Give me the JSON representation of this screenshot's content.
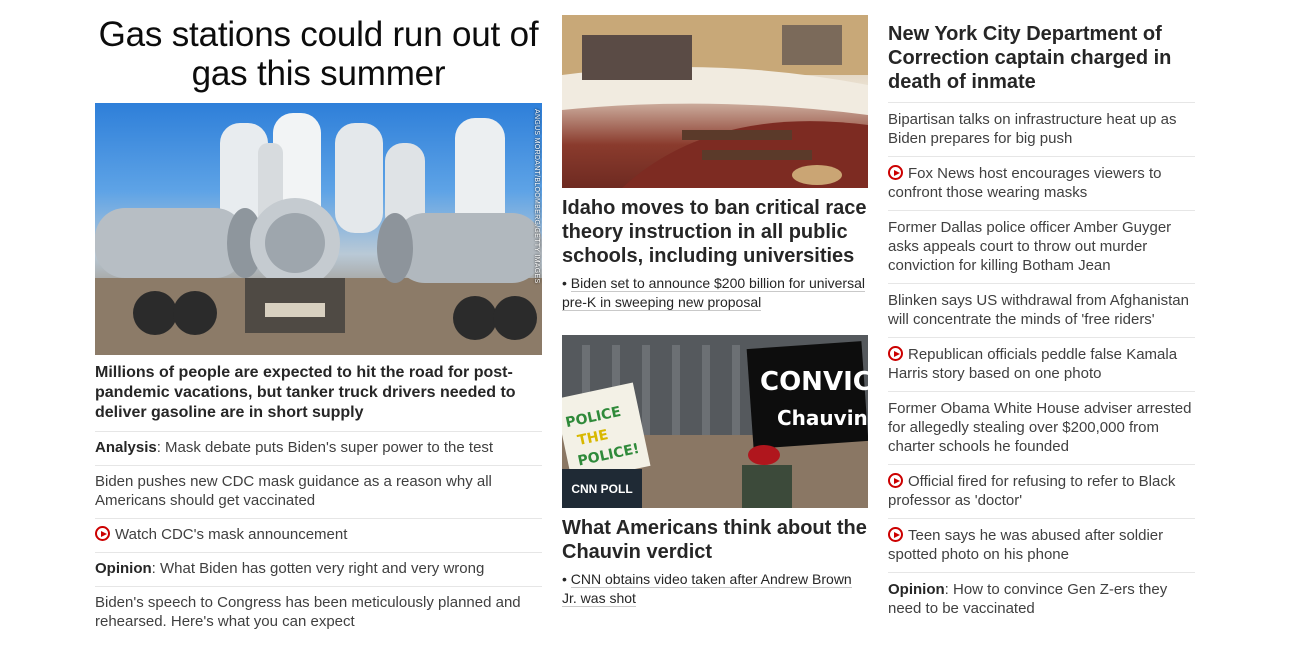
{
  "left": {
    "hero_title": "Gas stations could run out of gas this summer",
    "hero_image_caption": "ANGUS MORDANT/BLOOMBERG/GETTY IMAGES",
    "hero_description": "Millions of people are expected to hit the road for post-pandemic vacations, but tanker truck drivers needed to deliver gasoline are in short supply",
    "links": [
      {
        "prefix": "Analysis",
        "text": ": Mask debate puts Biden's super power to the test",
        "video": false
      },
      {
        "prefix": "",
        "text": "Biden pushes new CDC mask guidance as a reason why all Americans should get vaccinated",
        "video": false
      },
      {
        "prefix": "",
        "text": "Watch CDC's mask announcement",
        "video": true
      },
      {
        "prefix": "Opinion",
        "text": ": What Biden has gotten very right and very wrong",
        "video": false
      },
      {
        "prefix": "",
        "text": "Biden's speech to Congress has been meticulously planned and rehearsed. Here's what you can expect",
        "video": false
      }
    ]
  },
  "middle": {
    "story1": {
      "title": "Idaho moves to ban critical race theory instruction in all public schools, including universities",
      "sub_link": "Biden set to announce $200 billion for universal pre-K in sweeping new proposal"
    },
    "story2": {
      "badge": "CNN POLL",
      "sign_left": "POLICE THE POLICE!",
      "sign_right": "CONVICT Chauvin",
      "title": "What Americans think about the Chauvin verdict",
      "sub_link": "CNN obtains video taken after Andrew Brown Jr. was shot"
    }
  },
  "right": {
    "title": "New York City Department of Correction captain charged in death of inmate",
    "links": [
      {
        "prefix": "",
        "text": "Bipartisan talks on infrastructure heat up as Biden prepares for big push",
        "video": false
      },
      {
        "prefix": "",
        "text": "Fox News host encourages viewers to confront those wearing masks",
        "video": true
      },
      {
        "prefix": "",
        "text": "Former Dallas police officer Amber Guyger asks appeals court to throw out murder conviction for killing Botham Jean",
        "video": false
      },
      {
        "prefix": "",
        "text": "Blinken says US withdrawal from Afghanistan will concentrate the minds of 'free riders'",
        "video": false
      },
      {
        "prefix": "",
        "text": "Republican officials peddle false Kamala Harris story based on one photo",
        "video": true
      },
      {
        "prefix": "",
        "text": "Former Obama White House adviser arrested for allegedly stealing over $200,000 from charter schools he founded",
        "video": false
      },
      {
        "prefix": "",
        "text": "Official fired for refusing to refer to Black professor as 'doctor'",
        "video": true
      },
      {
        "prefix": "",
        "text": "Teen says he was abused after soldier spotted photo on his phone",
        "video": true
      },
      {
        "prefix": "Opinion",
        "text": ": How to convince Gen Z-ers they need to be vaccinated",
        "video": false
      }
    ]
  },
  "colors": {
    "video_icon": "#cc0000",
    "poll_badge_bg": "#1f2a35",
    "divider": "#e6e6e6"
  }
}
